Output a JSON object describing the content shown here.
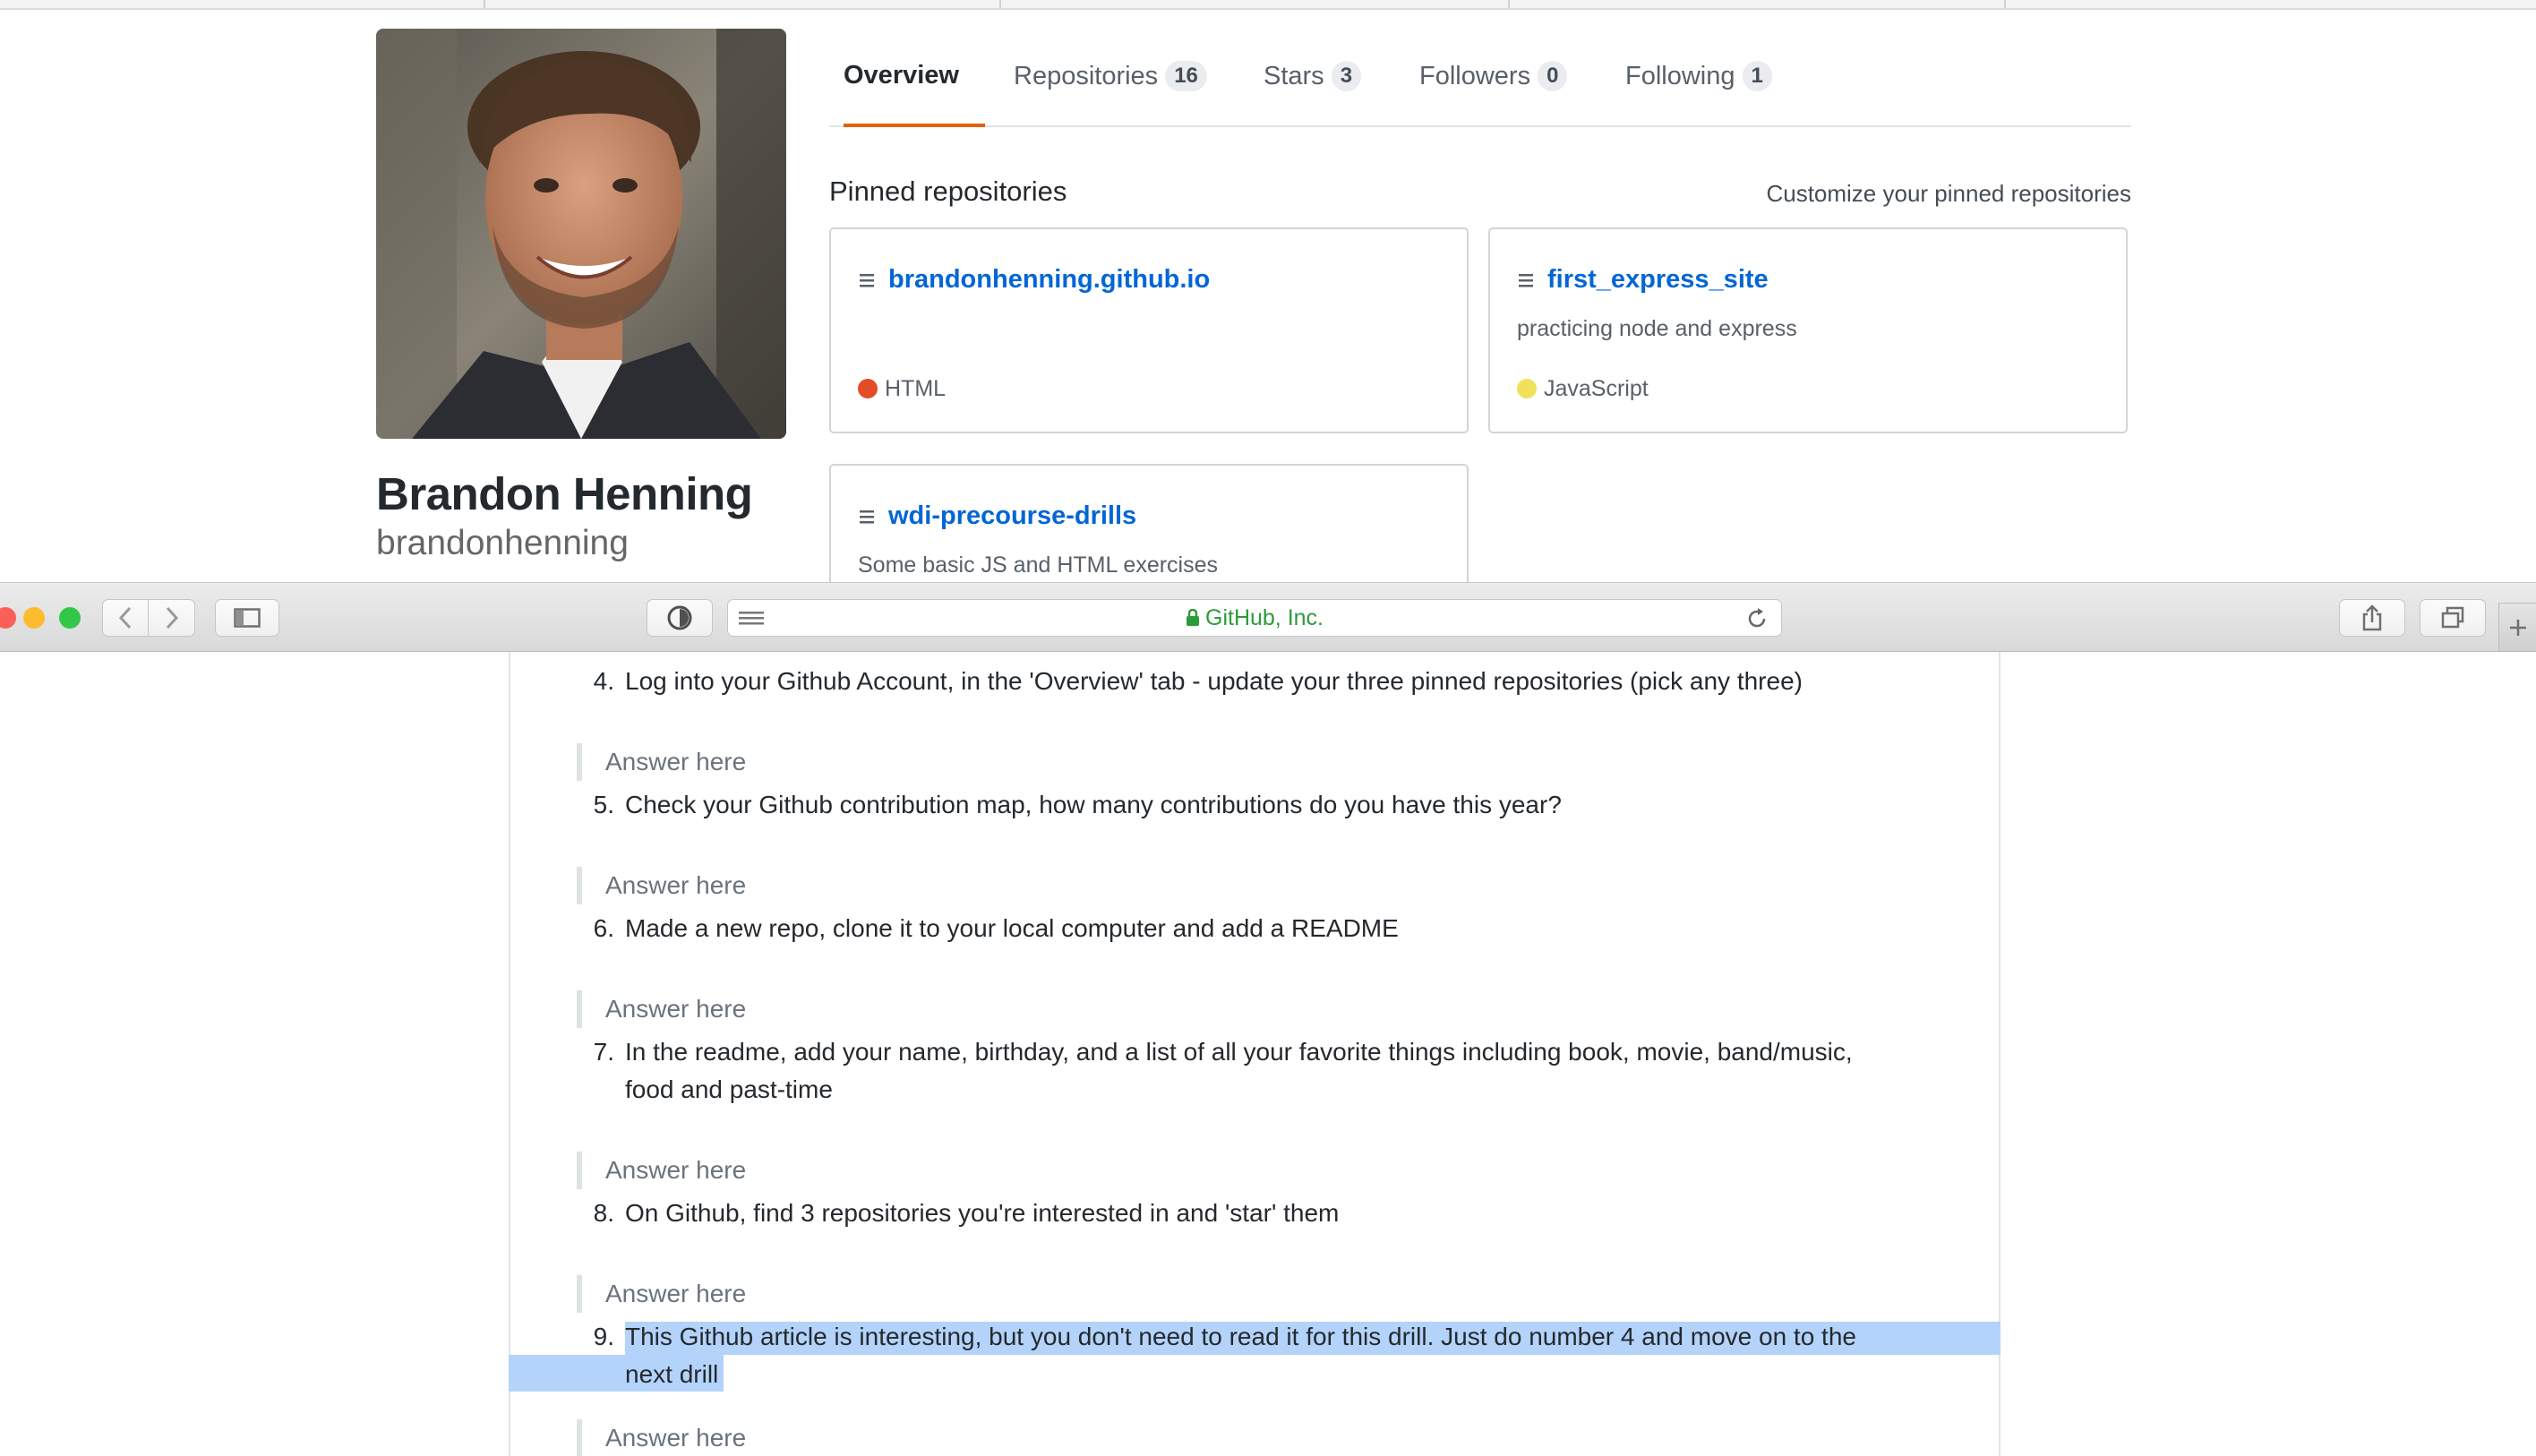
{
  "profile": {
    "name": "Brandon Henning",
    "login": "brandonhenning"
  },
  "tabs": [
    {
      "label": "Overview",
      "count": null,
      "active": true
    },
    {
      "label": "Repositories",
      "count": "16",
      "active": false
    },
    {
      "label": "Stars",
      "count": "3",
      "active": false
    },
    {
      "label": "Followers",
      "count": "0",
      "active": false
    },
    {
      "label": "Following",
      "count": "1",
      "active": false
    }
  ],
  "pinned": {
    "heading": "Pinned repositories",
    "customize_label": "Customize your pinned repositories",
    "repos": [
      {
        "name": "brandonhenning.github.io",
        "description": "",
        "language": "HTML",
        "language_color": "#e34c26"
      },
      {
        "name": "first_express_site",
        "description": "practicing node and express",
        "language": "JavaScript",
        "language_color": "#f1e05a"
      },
      {
        "name": "wdi-precourse-drills",
        "description": "Some basic JS and HTML exercises",
        "language": "",
        "language_color": ""
      }
    ]
  },
  "browser": {
    "address_text": "GitHub, Inc.",
    "secure": true,
    "traffic_lights": [
      "#fc5f57",
      "#fdbc2e",
      "#33c748"
    ]
  },
  "document": {
    "answer_placeholder": "Answer here",
    "items": [
      {
        "number": "4.",
        "lines": [
          "Log into your Github Account, in the 'Overview' tab - update your three pinned repositories (pick any three)"
        ]
      },
      {
        "number": "5.",
        "lines": [
          "Check your Github contribution map, how many contributions do you have this year?"
        ]
      },
      {
        "number": "6.",
        "lines": [
          "Made a new repo, clone it to your local computer and add a README"
        ]
      },
      {
        "number": "7.",
        "lines": [
          "In the readme, add your name, birthday, and a list of all your favorite things including book, movie, band/music,",
          "food and past-time"
        ]
      },
      {
        "number": "8.",
        "lines": [
          "On Github, find 3 repositories you're interested in and 'star' them"
        ]
      },
      {
        "number": "9.",
        "lines": [
          "This Github article is interesting, but you don't need to read it for this drill. Just do number 4 and move on to the",
          "next drill"
        ],
        "selected": true
      }
    ]
  }
}
